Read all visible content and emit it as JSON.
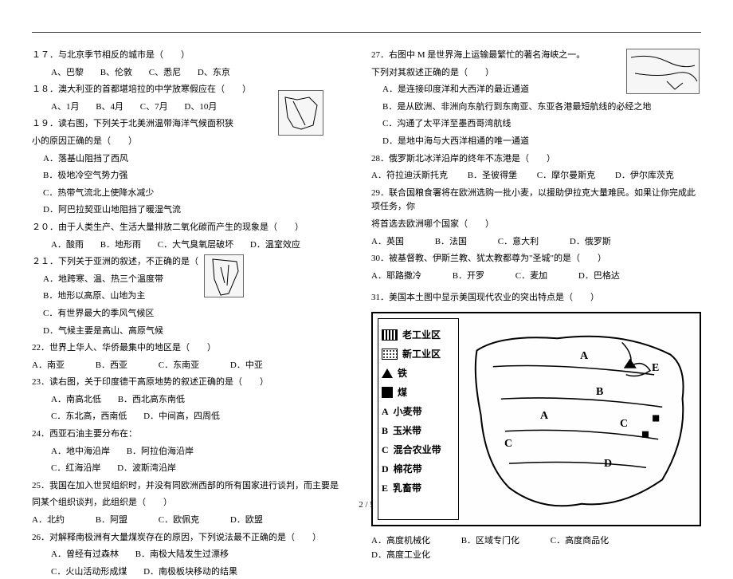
{
  "page_number": "2 / 5",
  "left": {
    "q17": "１７．与北京季节相反的城市是（　　）",
    "q17o": {
      "a": "A、巴黎",
      "b": "B、伦敦",
      "c": "C、悉尼",
      "d": "D、东京"
    },
    "q18": "１８．澳大利亚的首都堪培拉的中学放寒假应在（　　）",
    "q18o": {
      "a": "A、1月",
      "b": "B、4月",
      "c": "C、7月",
      "d": "D、10月"
    },
    "q19a": "１９．读右图，下列关于北美洲温带海洋气候面积狭",
    "q19b": "小的原因正确的是（　　）",
    "q19o": {
      "a": "A．落基山阻挡了西风",
      "b": "B．极地冷空气势力强",
      "c": "C．热带气流北上使降水减少",
      "d": "D．阿巴拉契亚山地阻挡了暖湿气流"
    },
    "q20": "２０．由于人类生产、生活大量排放二氧化碳而产生的现象是（　　）",
    "q20o": {
      "a": "A．酸雨",
      "b": "B．地形雨",
      "c": "C．大气臭氧层破坏",
      "d": "D．温室效应"
    },
    "q21": "２１．下列关于亚洲的叙述，不正确的是（　　）",
    "q21o": {
      "a": "A．地跨寒、温、热三个温度带",
      "b": "B．地形以高原、山地为主",
      "c": "C．有世界最大的季风气候区",
      "d": "D．气候主要是高山、高原气候"
    },
    "q22": "22．世界上华人、华侨最集中的地区是（　　）",
    "q22o": {
      "a": "A．南亚",
      "b": "B．西亚",
      "c": "C．东南亚",
      "d": "D．中亚"
    },
    "q23": "23．读右图，关于印度德干高原地势的叙述正确的是（　　）",
    "q23o": {
      "a": "A．南高北低",
      "b": "B．西北高东南低",
      "c": "C．东北高，西南低",
      "d": "D．中间高，四周低"
    },
    "q24": "24．西亚石油主要分布在：",
    "q24o": {
      "a": "A．地中海沿岸",
      "b": "B．阿拉伯海沿岸",
      "c": "C．红海沿岸",
      "d": "D．波斯湾沿岸"
    },
    "q25a": "25．我国在加入世贸组织时，并没有同欧洲西部的所有国家进行谈判，而主要是",
    "q25b": "同某个组织谈判，此组织是（　　）",
    "q25o": {
      "a": "A．北约",
      "b": "B．阿盟",
      "c": "C．欧佩克",
      "d": "D．欧盟"
    },
    "q26": "26．对解释南极洲有大量煤炭存在的原因，下列说法最不正确的是（　　）",
    "q26o": {
      "a": "A．曾经有过森林",
      "b": "B．南极大陆发生过漂移",
      "c": "C．火山活动形成煤",
      "d": "D．南极板块移动的结果"
    }
  },
  "right": {
    "q27a": "27．右图中 M 是世界海上运输最繁忙的著名海峡之一。",
    "q27b": "下列对其叙述正确的是（　　）",
    "q27o": {
      "a": "A．是连接印度洋和大西洋的最近通道",
      "b": "B．是从欧洲、非洲向东航行到东南亚、东亚各港最短航线的必经之地",
      "c": "C．沟通了太平洋至墨西哥湾航线",
      "d": "D．是地中海与大西洋相通的唯一通道"
    },
    "q28": "28．俄罗斯北冰洋沿岸的终年不冻港是（　　）",
    "q28o": {
      "a": "A．符拉迪沃斯托克",
      "b": "B．圣彼得堡",
      "c": "C．摩尔曼斯克",
      "d": "D．伊尔库茨克"
    },
    "q29a": "29．联合国粮食署将在欧洲选购一批小麦，以援助伊拉克大量难民。如果让你完成此项任务，你",
    "q29b": "将首选去欧洲哪个国家（　　）",
    "q29o": {
      "a": "A．英国",
      "b": "B．法国",
      "c": "C．意大利",
      "d": "D．俄罗斯"
    },
    "q30": "30．被基督教、伊斯兰教、犹太教都尊为\"圣城\"的是（　　）",
    "q30o": {
      "a": "A．耶路撒冷",
      "b": "B．开罗",
      "c": "C．麦加",
      "d": "D．巴格达"
    },
    "q31": "31．美国本土图中显示美国现代农业的突出特点是（　　）",
    "legend": {
      "l1": "老工业区",
      "l2": "新工业区",
      "l3": "铁",
      "l4": "煤",
      "l5": "小麦带",
      "l6": "玉米带",
      "l7": "混合农业带",
      "l8": "棉花带",
      "l9": "乳畜带"
    },
    "maplabels": {
      "A": "A",
      "B": "B",
      "C": "C",
      "D": "D",
      "E": "E"
    },
    "q31o": {
      "a": "A．高度机械化",
      "b": "B．区域专门化",
      "c": "C．高度商品化",
      "d": "D．高度工业化"
    }
  }
}
